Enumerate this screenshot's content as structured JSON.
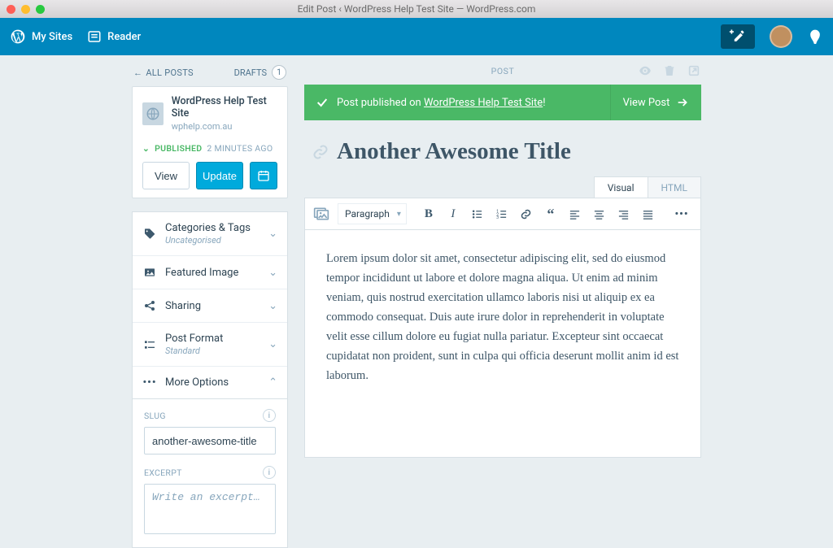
{
  "window_title": "Edit Post ‹ WordPress Help Test Site — WordPress.com",
  "masterbar": {
    "my_sites": "My Sites",
    "reader": "Reader"
  },
  "sidebar": {
    "back": "ALL POSTS",
    "drafts_label": "DRAFTS",
    "drafts_count": "1",
    "site_name": "WordPress Help Test Site",
    "site_url": "wphelp.com.au",
    "status": "PUBLISHED",
    "status_time": "2 MINUTES AGO",
    "view_btn": "View",
    "update_btn": "Update",
    "acc": {
      "cats": "Categories & Tags",
      "cats_sub": "Uncategorised",
      "featured": "Featured Image",
      "sharing": "Sharing",
      "format": "Post Format",
      "format_sub": "Standard",
      "more": "More Options"
    },
    "slug_label": "SLUG",
    "slug_value": "another-awesome-title",
    "excerpt_label": "EXCERPT",
    "excerpt_placeholder": "Write an excerpt…"
  },
  "editor": {
    "nav_label": "POST",
    "notice_prefix": "Post published on ",
    "notice_site": "WordPress Help Test Site",
    "notice_suffix": "!",
    "view_post": "View Post",
    "title": "Another Awesome Title",
    "tab_visual": "Visual",
    "tab_html": "HTML",
    "paragraph": "Paragraph",
    "body": "Lorem ipsum dolor sit amet, consectetur adipiscing elit, sed do eiusmod tempor incididunt ut labore et dolore magna aliqua. Ut enim ad minim veniam, quis nostrud exercitation ullamco laboris nisi ut aliquip ex ea commodo consequat. Duis aute irure dolor in reprehenderit in voluptate velit esse cillum dolore eu fugiat nulla pariatur. Excepteur sint occaecat cupidatat non proident, sunt in culpa qui officia deserunt mollit anim id est laborum."
  }
}
